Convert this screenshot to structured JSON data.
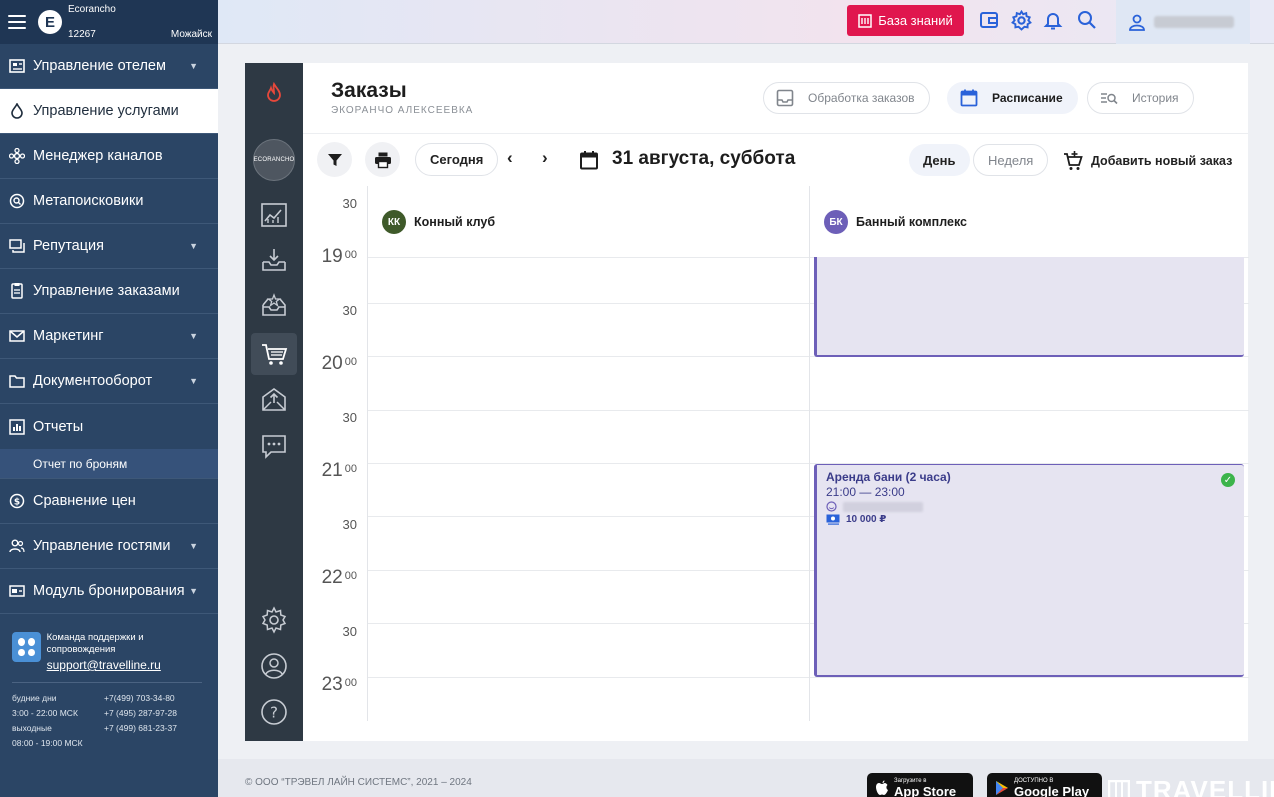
{
  "sidebar": {
    "hotel_name": "Ecorancho",
    "hotel_id": "12267",
    "hotel_city": "Можайск",
    "logo_letter": "E",
    "items": [
      {
        "label": "Управление отелем",
        "icon": "hotel-icon",
        "expandable": true
      },
      {
        "label": "Управление услугами",
        "icon": "services-icon",
        "expandable": false,
        "active": true
      },
      {
        "label": "Менеджер каналов",
        "icon": "channels-icon",
        "expandable": false
      },
      {
        "label": "Метапоисковики",
        "icon": "meta-search-icon",
        "expandable": false
      },
      {
        "label": "Репутация",
        "icon": "reputation-icon",
        "expandable": true
      },
      {
        "label": "Управление заказами",
        "icon": "orders-icon",
        "expandable": false
      },
      {
        "label": "Маркетинг",
        "icon": "marketing-icon",
        "expandable": true
      },
      {
        "label": "Документооборот",
        "icon": "documents-icon",
        "expandable": true
      },
      {
        "label": "Отчеты",
        "icon": "reports-icon",
        "expandable": false
      }
    ],
    "sub_item": "Отчет по броням",
    "items2": [
      {
        "label": "Сравнение цен",
        "icon": "price-compare-icon",
        "expandable": false
      },
      {
        "label": "Управление гостями",
        "icon": "guests-icon",
        "expandable": true
      },
      {
        "label": "Модуль бронирования",
        "icon": "booking-module-icon",
        "expandable": true
      }
    ],
    "support": {
      "title": "Команда поддержки и сопровождения",
      "email": "support@travelline.ru",
      "weekdays_label": "будние дни",
      "weekdays_hours": "3:00 - 22:00 МСК",
      "weekend_label": "выходные",
      "weekend_hours": "08:00 - 19:00 МСК",
      "phones": [
        "+7(499) 703-34-80",
        "+7 (495) 287-97-28",
        "+7 (499) 681-23-37"
      ]
    }
  },
  "topbar": {
    "knowledge_base": "База знаний",
    "icons": [
      "wallet-icon",
      "gear-icon",
      "bell-icon",
      "search-icon",
      "user-icon"
    ]
  },
  "header": {
    "title": "Заказы",
    "subtitle": "ЭКОРАНЧО АЛЕКСЕЕВКА",
    "tabs": [
      {
        "label": "Обработка заказов",
        "active": false
      },
      {
        "label": "Расписание",
        "active": true
      },
      {
        "label": "История",
        "active": false
      }
    ]
  },
  "rail": {
    "avatar_text": "ECORANCHO"
  },
  "toolbar": {
    "today": "Сегодня",
    "date": "31 августа, суббота",
    "day": "День",
    "week": "Неделя",
    "add_order": "Добавить новый заказ"
  },
  "calendar": {
    "times": [
      {
        "h": "",
        "m": "30"
      },
      {
        "h": "19",
        "m": "00"
      },
      {
        "h": "",
        "m": "30"
      },
      {
        "h": "20",
        "m": "00"
      },
      {
        "h": "",
        "m": "30"
      },
      {
        "h": "21",
        "m": "00"
      },
      {
        "h": "",
        "m": "30"
      },
      {
        "h": "22",
        "m": "00"
      },
      {
        "h": "",
        "m": "30"
      },
      {
        "h": "23",
        "m": "00"
      }
    ],
    "columns": [
      {
        "initials": "КК",
        "name": "Конный клуб",
        "color": "#3f5a2a"
      },
      {
        "initials": "БК",
        "name": "Банный комплекс",
        "color": "#6d5fb8"
      }
    ],
    "events": [
      {
        "title": "",
        "time": "",
        "price": "",
        "confirmed": false
      },
      {
        "title": "Аренда бани (2 часа)",
        "time": "21:00 — 23:00",
        "price": "10 000 ₽",
        "confirmed": true
      }
    ]
  },
  "footer": {
    "copyright": "© ООО “ТРЭВЕЛ ЛАЙН СИСТЕМС”, 2021 – 2024",
    "appstore_small": "Загрузите в",
    "appstore_big": "App Store",
    "gplay_small": "ДОСТУПНО В",
    "gplay_big": "Google Play",
    "brand": "TRAVELLINE"
  },
  "colors": {
    "sidebar_bg": "#2b4565",
    "accent_red": "#e0164e",
    "accent_blue": "#2a62d9",
    "event_purple": "#6d5fb8",
    "rail_bg": "#2e3944"
  }
}
